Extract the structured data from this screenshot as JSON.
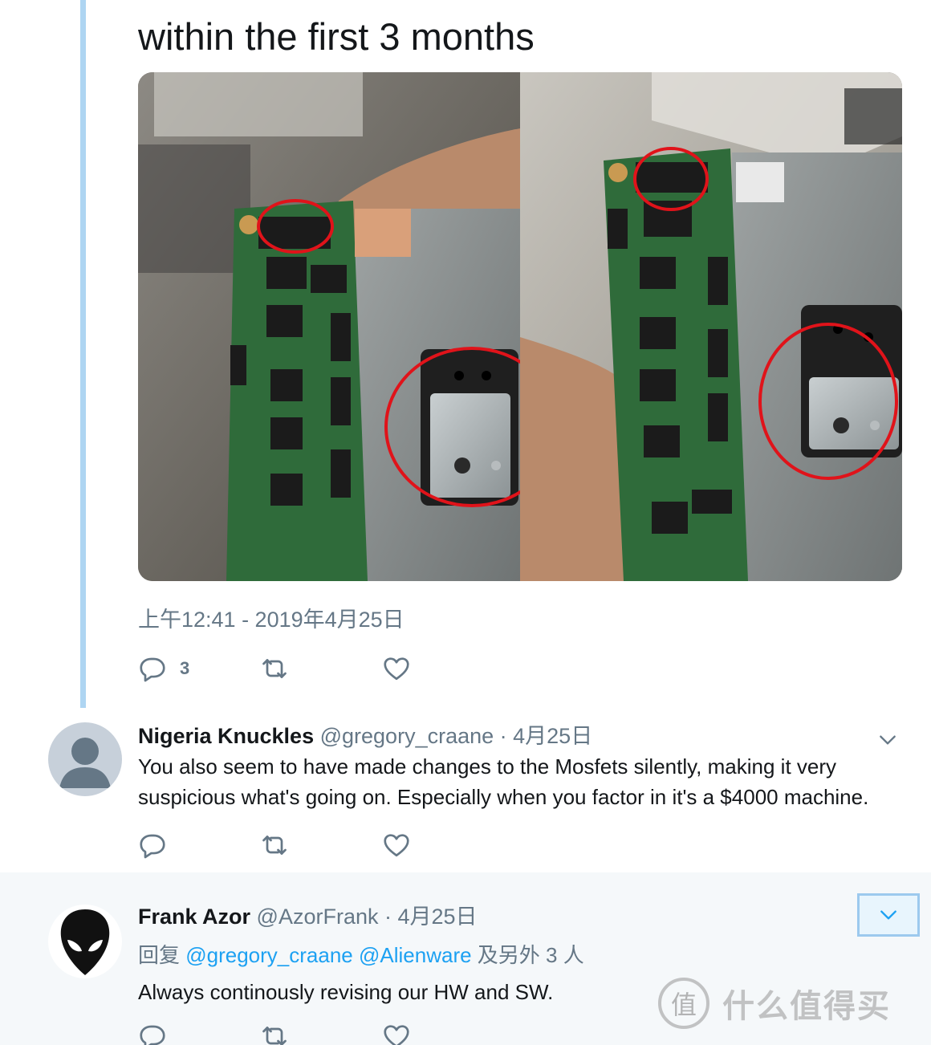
{
  "tweet": {
    "text": "within the first 3 months",
    "timestamp": "上午12:41 - 2019年4月25日",
    "reply_count": "3",
    "media_alt": "photo"
  },
  "replies": [
    {
      "name": "Nigeria Knuckles",
      "handle": "@gregory_craane",
      "meta": "· 4月25日",
      "text": "You also seem to have made changes to the Mosfets silently, making it very suspicious what's going on. Especially when you factor in it's a $4000 machine."
    },
    {
      "name": "Frank Azor",
      "handle": "@AzorFrank",
      "meta": "· 4月25日",
      "reply_prefix": "回复",
      "mention1": "@gregory_craane",
      "mention2": "@Alienware",
      "reply_suffix": "及另外 3 人",
      "text": "Always continously revising our HW and SW."
    }
  ],
  "watermark": {
    "badge": "值",
    "text": "什么值得买"
  },
  "colors": {
    "accent": "#1da1f2",
    "muted": "#657786",
    "thread_line": "#aed5f2",
    "highlight_circle": "#e0131a"
  }
}
